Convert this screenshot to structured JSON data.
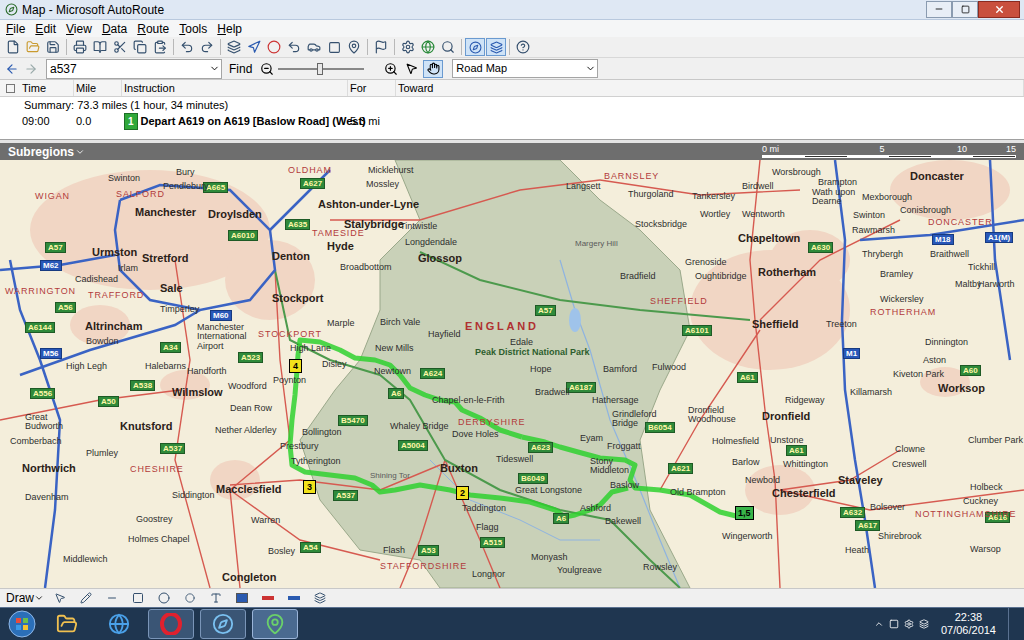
{
  "window": {
    "title": "Map - Microsoft AutoRoute"
  },
  "menu": [
    "File",
    "Edit",
    "View",
    "Data",
    "Route",
    "Tools",
    "Help"
  ],
  "search": {
    "value": "a537",
    "button": "Find"
  },
  "zoom": {
    "level": 0.48
  },
  "map_style": {
    "value": "Road Map"
  },
  "directions": {
    "columns": [
      "Time",
      "Mile",
      "Instruction",
      "For",
      "Toward"
    ],
    "summary": "Summary: 73.3 miles (1 hour, 34 minutes)",
    "rows": [
      {
        "time": "09:00",
        "mile": "0.0",
        "step": "1",
        "instruction": "Depart A619 on A619 [Baslow Road] (West)",
        "for": "5.3 mi",
        "toward": "",
        "selected": false
      }
    ]
  },
  "subregions": {
    "label": "Subregions"
  },
  "scale": {
    "ticks": [
      "0 mi",
      "5",
      "10",
      "15"
    ]
  },
  "map": {
    "places": [
      {
        "text": "Bury",
        "kind": "town"
      },
      {
        "text": "Swinton",
        "kind": "town"
      },
      {
        "text": "Pendlebury",
        "kind": "town"
      },
      {
        "text": "OLDHAM",
        "kind": "district"
      },
      {
        "text": "Micklehurst",
        "kind": "town"
      },
      {
        "text": "Mossley",
        "kind": "town"
      },
      {
        "text": "Langsett",
        "kind": "town"
      },
      {
        "text": "BARNSLEY",
        "kind": "district"
      },
      {
        "text": "Thurgoland",
        "kind": "town"
      },
      {
        "text": "Tankersley",
        "kind": "town"
      },
      {
        "text": "Birdwell",
        "kind": "town"
      },
      {
        "text": "Worsbrough",
        "kind": "town"
      },
      {
        "text": "Brampton",
        "kind": "town"
      },
      {
        "text": "Doncaster",
        "kind": "city"
      },
      {
        "text": "Wath upon Dearne",
        "kind": "stacked"
      },
      {
        "text": "Mexborough",
        "kind": "town"
      },
      {
        "text": "Swinton",
        "kind": "town"
      },
      {
        "text": "Conisbrough",
        "kind": "town"
      },
      {
        "text": "DONCASTER",
        "kind": "district"
      },
      {
        "text": "Rawmarsh",
        "kind": "town"
      },
      {
        "text": "Wortley",
        "kind": "town"
      },
      {
        "text": "Wentworth",
        "kind": "town"
      },
      {
        "text": "Stocksbridge",
        "kind": "town"
      },
      {
        "text": "Margery Hill",
        "kind": "feature"
      },
      {
        "text": "Chapeltown",
        "kind": "city"
      },
      {
        "text": "Rotherham",
        "kind": "city"
      },
      {
        "text": "Thrybergh",
        "kind": "town"
      },
      {
        "text": "Braithwell",
        "kind": "town"
      },
      {
        "text": "Tickhill",
        "kind": "town"
      },
      {
        "text": "Maltby",
        "kind": "town"
      },
      {
        "text": "Bramley",
        "kind": "town"
      },
      {
        "text": "Wickersley",
        "kind": "town"
      },
      {
        "text": "ROTHERHAM",
        "kind": "district"
      },
      {
        "text": "Harworth",
        "kind": "town"
      },
      {
        "text": "Grenoside",
        "kind": "town"
      },
      {
        "text": "Oughtibridge",
        "kind": "town"
      },
      {
        "text": "Bradfield",
        "kind": "town"
      },
      {
        "text": "SHEFFIELD",
        "kind": "district"
      },
      {
        "text": "Sheffield",
        "kind": "city"
      },
      {
        "text": "Treeton",
        "kind": "town"
      },
      {
        "text": "Dinnington",
        "kind": "town"
      },
      {
        "text": "Aston",
        "kind": "town"
      },
      {
        "text": "Kiveton Park",
        "kind": "town"
      },
      {
        "text": "Killamarsh",
        "kind": "town"
      },
      {
        "text": "Worksop",
        "kind": "city"
      },
      {
        "text": "Clumber Park",
        "kind": "stacked"
      },
      {
        "text": "Ridgeway",
        "kind": "town"
      },
      {
        "text": "Dronfield",
        "kind": "city"
      },
      {
        "text": "Dronfield Woodhouse",
        "kind": "stacked"
      },
      {
        "text": "Unstone",
        "kind": "town"
      },
      {
        "text": "Holmesfield",
        "kind": "town"
      },
      {
        "text": "Barlow",
        "kind": "town"
      },
      {
        "text": "Whittington",
        "kind": "town"
      },
      {
        "text": "Staveley",
        "kind": "city"
      },
      {
        "text": "Clowne",
        "kind": "town"
      },
      {
        "text": "Creswell",
        "kind": "town"
      },
      {
        "text": "Holbeck",
        "kind": "town"
      },
      {
        "text": "Cuckney",
        "kind": "town"
      },
      {
        "text": "NOTTINGHAMSHIRE",
        "kind": "district"
      },
      {
        "text": "Chesterfield",
        "kind": "city"
      },
      {
        "text": "Newbold",
        "kind": "town"
      },
      {
        "text": "Old Brampton",
        "kind": "town"
      },
      {
        "text": "Bolsover",
        "kind": "town"
      },
      {
        "text": "Wingerworth",
        "kind": "town"
      },
      {
        "text": "Heath",
        "kind": "town"
      },
      {
        "text": "Shirebrook",
        "kind": "town"
      },
      {
        "text": "Warsop",
        "kind": "town"
      },
      {
        "text": "Fulwood",
        "kind": "town"
      },
      {
        "text": "Bamford",
        "kind": "town"
      },
      {
        "text": "Hope",
        "kind": "town"
      },
      {
        "text": "Edale",
        "kind": "town"
      },
      {
        "text": "Bradwell",
        "kind": "town"
      },
      {
        "text": "Hathersage",
        "kind": "town"
      },
      {
        "text": "Grindleford Bridge",
        "kind": "stacked"
      },
      {
        "text": "Froggatt",
        "kind": "town"
      },
      {
        "text": "Eyam",
        "kind": "town"
      },
      {
        "text": "Tideswell",
        "kind": "town"
      },
      {
        "text": "Stony Middleton",
        "kind": "stacked"
      },
      {
        "text": "Baslow",
        "kind": "town"
      },
      {
        "text": "Great Longstone",
        "kind": "town"
      },
      {
        "text": "Taddington",
        "kind": "town"
      },
      {
        "text": "Ashford",
        "kind": "town"
      },
      {
        "text": "Bakewell",
        "kind": "town"
      },
      {
        "text": "Flagg",
        "kind": "town"
      },
      {
        "text": "Monyash",
        "kind": "town"
      },
      {
        "text": "Youlgreave",
        "kind": "town"
      },
      {
        "text": "Rowsley",
        "kind": "town"
      },
      {
        "text": "Longnor",
        "kind": "town"
      },
      {
        "text": "Buxton",
        "kind": "city"
      },
      {
        "text": "Dove Holes",
        "kind": "town"
      },
      {
        "text": "Chapel-en-le-Frith",
        "kind": "town"
      },
      {
        "text": "Whaley Bridge",
        "kind": "stacked"
      },
      {
        "text": "Newtown",
        "kind": "town"
      },
      {
        "text": "New Mills",
        "kind": "town"
      },
      {
        "text": "Hayfield",
        "kind": "town"
      },
      {
        "text": "Birch Vale",
        "kind": "stacked"
      },
      {
        "text": "Glossop",
        "kind": "city"
      },
      {
        "text": "Tintwistle",
        "kind": "town"
      },
      {
        "text": "Longdendale",
        "kind": "town"
      },
      {
        "text": "Stalybridge",
        "kind": "city"
      },
      {
        "text": "Ashton-under-Lyne",
        "kind": "city"
      },
      {
        "text": "TAMESIDE",
        "kind": "district"
      },
      {
        "text": "Hyde",
        "kind": "city"
      },
      {
        "text": "Denton",
        "kind": "city"
      },
      {
        "text": "Broadbottom",
        "kind": "town"
      },
      {
        "text": "Marple",
        "kind": "town"
      },
      {
        "text": "Stockport",
        "kind": "city"
      },
      {
        "text": "STOCKPORT",
        "kind": "district"
      },
      {
        "text": "High Lane",
        "kind": "town"
      },
      {
        "text": "Disley",
        "kind": "town"
      },
      {
        "text": "Poynton",
        "kind": "town"
      },
      {
        "text": "Bollington",
        "kind": "town"
      },
      {
        "text": "Prestbury",
        "kind": "town"
      },
      {
        "text": "Tytherington",
        "kind": "town"
      },
      {
        "text": "Macclesfield",
        "kind": "city"
      },
      {
        "text": "Shining Tor",
        "kind": "feature"
      },
      {
        "text": "Flash",
        "kind": "town"
      },
      {
        "text": "Bosley",
        "kind": "town"
      },
      {
        "text": "Congleton",
        "kind": "city"
      },
      {
        "text": "Warren",
        "kind": "town"
      },
      {
        "text": "Siddington",
        "kind": "town"
      },
      {
        "text": "Goostrey",
        "kind": "town"
      },
      {
        "text": "Holmes Chapel",
        "kind": "town"
      },
      {
        "text": "Davenham",
        "kind": "town"
      },
      {
        "text": "Middlewich",
        "kind": "town"
      },
      {
        "text": "Northwich",
        "kind": "city"
      },
      {
        "text": "Comberbach",
        "kind": "town"
      },
      {
        "text": "Great Budworth",
        "kind": "stacked"
      },
      {
        "text": "Plumley",
        "kind": "town"
      },
      {
        "text": "Knutsford",
        "kind": "city"
      },
      {
        "text": "Wilmslow",
        "kind": "city"
      },
      {
        "text": "Woodford",
        "kind": "town"
      },
      {
        "text": "Dean Row",
        "kind": "town"
      },
      {
        "text": "Handforth",
        "kind": "town"
      },
      {
        "text": "Nether Alderley",
        "kind": "stacked"
      },
      {
        "text": "Altrincham",
        "kind": "city"
      },
      {
        "text": "Timperley",
        "kind": "town"
      },
      {
        "text": "Sale",
        "kind": "city"
      },
      {
        "text": "Cadishead",
        "kind": "town"
      },
      {
        "text": "Irlam",
        "kind": "town"
      },
      {
        "text": "Urmston",
        "kind": "city"
      },
      {
        "text": "Stretford",
        "kind": "city"
      },
      {
        "text": "Manchester",
        "kind": "city"
      },
      {
        "text": "SALFORD",
        "kind": "district"
      },
      {
        "text": "Droylsden",
        "kind": "city"
      },
      {
        "text": "WIGAN",
        "kind": "district"
      },
      {
        "text": "WARRINGTON",
        "kind": "district"
      },
      {
        "text": "TRAFFORD",
        "kind": "district"
      },
      {
        "text": "High Legh",
        "kind": "town"
      },
      {
        "text": "Bowdon",
        "kind": "town"
      },
      {
        "text": "Halebarns",
        "kind": "town"
      },
      {
        "text": "Manchester International Airport",
        "kind": "stacked"
      },
      {
        "text": "ENGLAND",
        "kind": "region"
      },
      {
        "text": "Peak District National Park",
        "kind": "park"
      },
      {
        "text": "DERBYSHIRE",
        "kind": "district"
      },
      {
        "text": "CHESHIRE",
        "kind": "district"
      },
      {
        "text": "STAFFORDSHIRE",
        "kind": "district"
      }
    ],
    "roads": [
      {
        "text": "A665",
        "kind": "primary"
      },
      {
        "text": "A627",
        "kind": "primary"
      },
      {
        "text": "A635",
        "kind": "primary"
      },
      {
        "text": "A6010",
        "kind": "primary"
      },
      {
        "text": "M62",
        "kind": "motorway"
      },
      {
        "text": "A57",
        "kind": "primary"
      },
      {
        "text": "A56",
        "kind": "primary"
      },
      {
        "text": "M60",
        "kind": "motorway"
      },
      {
        "text": "A6144",
        "kind": "primary"
      },
      {
        "text": "M56",
        "kind": "motorway"
      },
      {
        "text": "A34",
        "kind": "primary"
      },
      {
        "text": "A538",
        "kind": "primary"
      },
      {
        "text": "A556",
        "kind": "primary"
      },
      {
        "text": "A50",
        "kind": "primary"
      },
      {
        "text": "A537",
        "kind": "primary"
      },
      {
        "text": "A523",
        "kind": "primary"
      },
      {
        "text": "A54",
        "kind": "primary"
      },
      {
        "text": "A537",
        "kind": "primary"
      },
      {
        "text": "A5004",
        "kind": "primary"
      },
      {
        "text": "B5470",
        "kind": "primary"
      },
      {
        "text": "A6",
        "kind": "primary"
      },
      {
        "text": "A624",
        "kind": "primary"
      },
      {
        "text": "A53",
        "kind": "primary"
      },
      {
        "text": "A515",
        "kind": "primary"
      },
      {
        "text": "A6",
        "kind": "primary"
      },
      {
        "text": "B6049",
        "kind": "primary"
      },
      {
        "text": "A623",
        "kind": "primary"
      },
      {
        "text": "A6187",
        "kind": "primary"
      },
      {
        "text": "A57",
        "kind": "primary"
      },
      {
        "text": "A61",
        "kind": "primary"
      },
      {
        "text": "A621",
        "kind": "primary"
      },
      {
        "text": "A6101",
        "kind": "primary"
      },
      {
        "text": "B6054",
        "kind": "primary"
      },
      {
        "text": "A630",
        "kind": "primary"
      },
      {
        "text": "M1",
        "kind": "motorway"
      },
      {
        "text": "M18",
        "kind": "motorway"
      },
      {
        "text": "A1(M)",
        "kind": "motorway"
      },
      {
        "text": "A60",
        "kind": "primary"
      },
      {
        "text": "A616",
        "kind": "primary"
      },
      {
        "text": "A617",
        "kind": "primary"
      },
      {
        "text": "A632",
        "kind": "primary"
      },
      {
        "text": "A61",
        "kind": "primary"
      }
    ],
    "markers": [
      {
        "label": "1,5",
        "color": "#39b54a"
      },
      {
        "label": "2",
        "color": "#f2e21b"
      },
      {
        "label": "3",
        "color": "#f2e21b"
      },
      {
        "label": "4",
        "color": "#f2e21b"
      }
    ]
  },
  "draw_toolbar": {
    "label": "Draw"
  },
  "taskbar": {
    "time": "22:38",
    "date": "07/06/2014"
  }
}
